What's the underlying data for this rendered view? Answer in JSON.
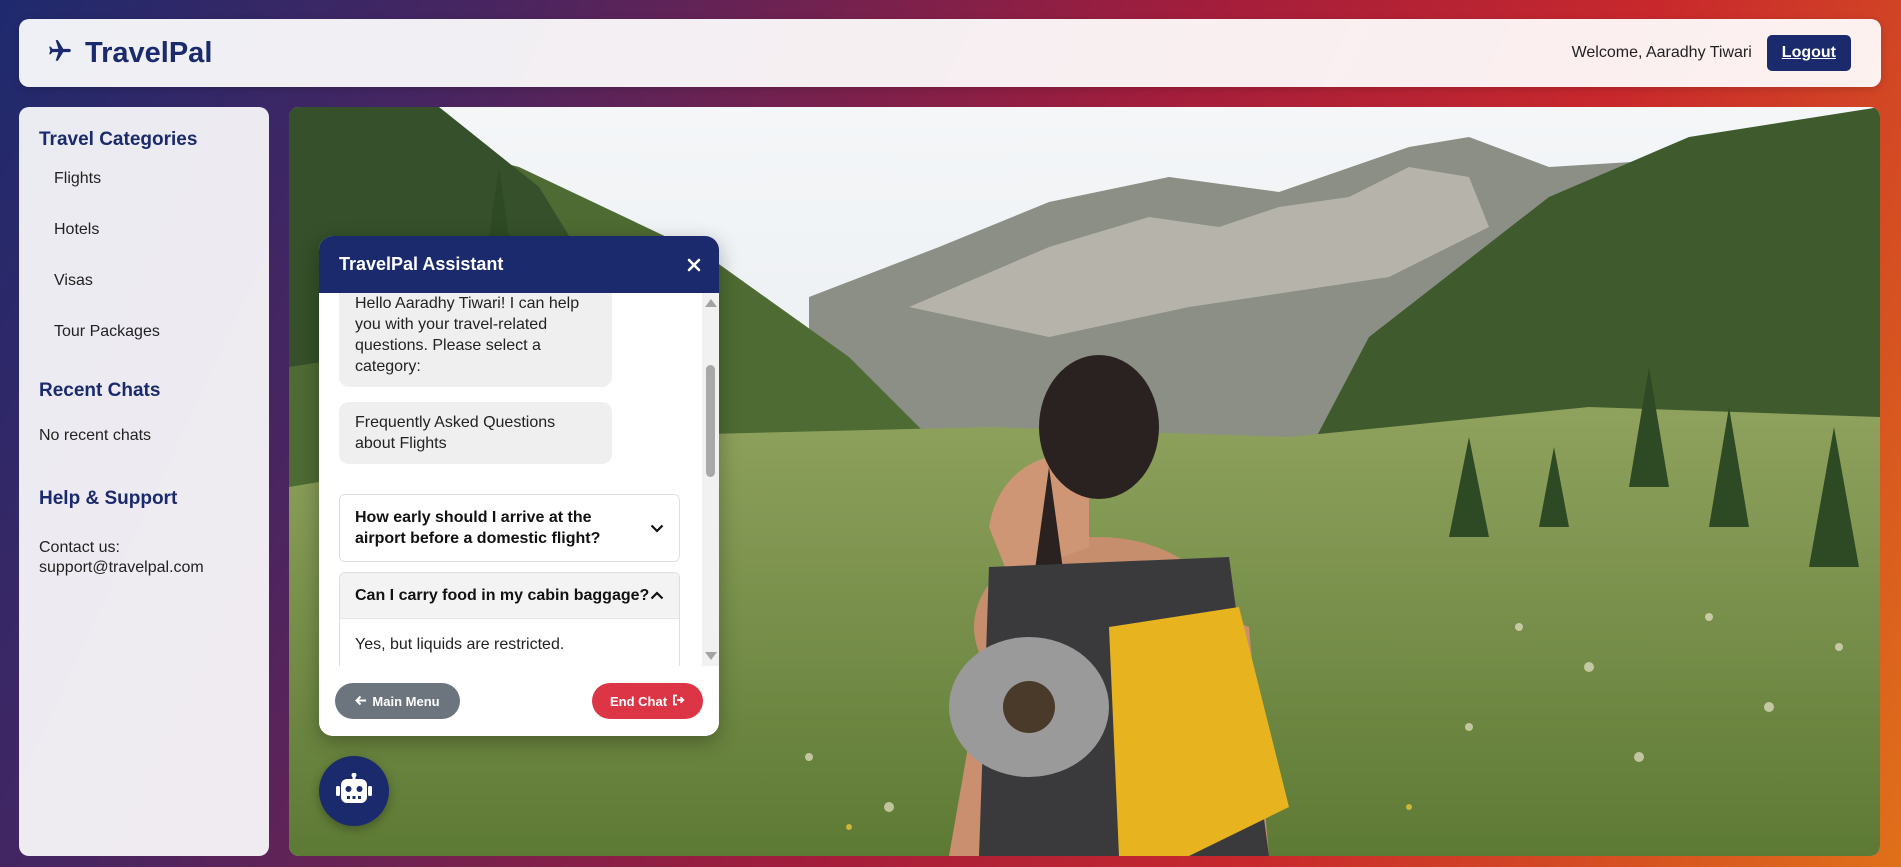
{
  "header": {
    "brand": "TravelPal",
    "brand_icon": "plane-icon",
    "welcome": "Welcome, Aaradhy Tiwari",
    "logout_label": "Logout"
  },
  "sidebar": {
    "categories_title": "Travel Categories",
    "categories": [
      {
        "label": "Flights"
      },
      {
        "label": "Hotels"
      },
      {
        "label": "Visas"
      },
      {
        "label": "Tour Packages"
      }
    ],
    "recent_title": "Recent Chats",
    "recent_empty": "No recent chats",
    "help_title": "Help & Support",
    "contact_label": "Contact us:",
    "contact_email": "support@travelpal.com"
  },
  "chat": {
    "title": "TravelPal Assistant",
    "messages": [
      {
        "text": "Hello Aaradhy Tiwari! I can help you with your travel-related questions. Please select a category:"
      },
      {
        "text": "Frequently Asked Questions about Flights"
      }
    ],
    "faqs": [
      {
        "question": "How early should I arrive at the airport before a domestic flight?",
        "expanded": false
      },
      {
        "question": "Can I carry food in my cabin baggage?",
        "expanded": true,
        "answer": "Yes, but liquids are restricted."
      }
    ],
    "main_menu_label": "Main Menu",
    "end_chat_label": "End Chat"
  },
  "colors": {
    "brand_navy": "#1a2a6c",
    "danger_red": "#dc3545",
    "secondary_gray": "#6c757d"
  }
}
